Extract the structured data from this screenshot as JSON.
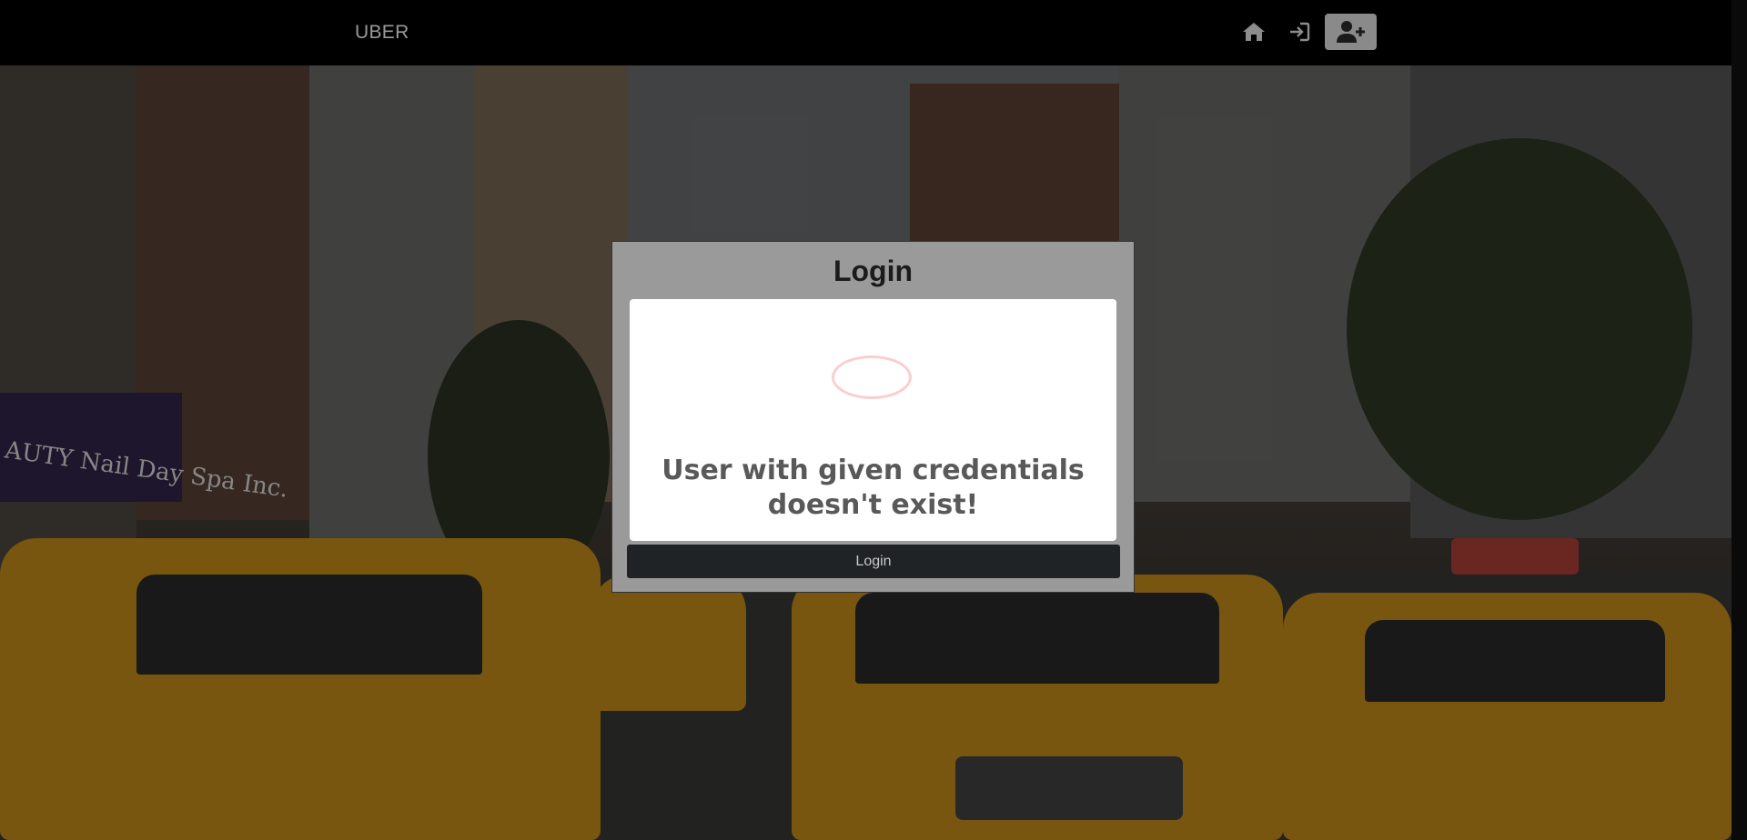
{
  "navbar": {
    "brand": "UBER",
    "icons": [
      "home-icon",
      "login-icon",
      "user-plus-icon"
    ],
    "register_bg": "#8a8a8a"
  },
  "login_form": {
    "title": "Login",
    "submit_label": "Login"
  },
  "alert": {
    "icon": "error-circle-icon",
    "message_line1": "User with given credentials",
    "message_line2": "doesn't exist!"
  },
  "background": {
    "awning_text": "AUTY Nail Day Spa Inc."
  },
  "colors": {
    "navbar_bg": "#000000",
    "card_bg": "#9a9a9a",
    "button_bg": "#1f2326",
    "alert_icon": "#f27474"
  }
}
